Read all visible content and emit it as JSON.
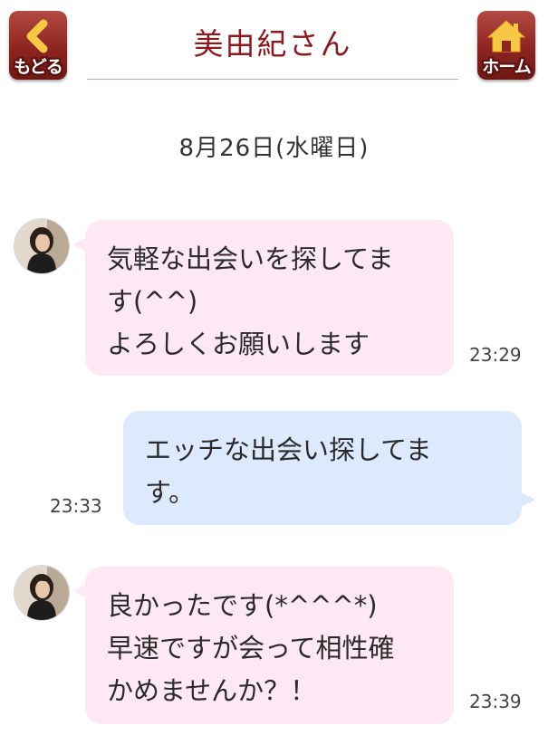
{
  "header": {
    "title": "美由紀さん",
    "back_label": "もどる",
    "home_label": "ホーム",
    "back_icon": "chevron-left-icon",
    "home_icon": "house-icon"
  },
  "date": "8月26日(水曜日)",
  "messages": [
    {
      "sender": "other",
      "lines": [
        "気軽な出会いを探してま",
        "す(^^)",
        "よろしくお願いします"
      ],
      "time": "23:29"
    },
    {
      "sender": "me",
      "lines": [
        "エッチな出会い探してま",
        "す。"
      ],
      "time": "23:33"
    },
    {
      "sender": "other",
      "lines": [
        "良かったです(*^^^*)",
        "早速ですが会って相性確",
        "かめませんか？！"
      ],
      "time": "23:39"
    }
  ],
  "colors": {
    "accent": "#8c1a1e",
    "incoming_bubble": "#fde8f4",
    "outgoing_bubble": "#dde9fd"
  }
}
